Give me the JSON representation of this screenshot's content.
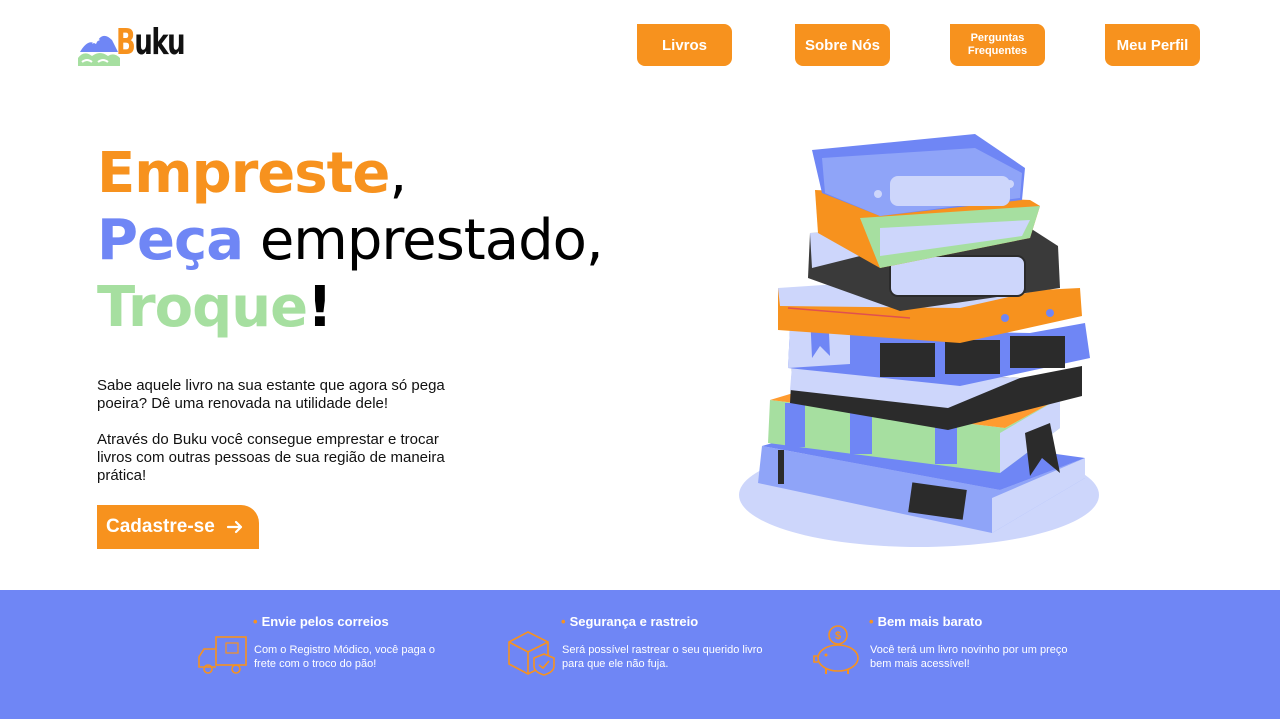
{
  "brand": {
    "name_b": "B",
    "name_rest": "uku"
  },
  "nav": {
    "items": [
      {
        "label": "Livros"
      },
      {
        "label": "Sobre Nós"
      },
      {
        "label": "Perguntas Frequentes"
      },
      {
        "label": "Meu Perfil"
      }
    ]
  },
  "hero": {
    "line1_word": "Empreste",
    "line1_punct": ",",
    "line2_word": "Peça",
    "line2_rest": " emprestado,",
    "line3_word": "Troque",
    "line3_punct": "!",
    "paragraph1": "Sabe aquele livro na sua estante que agora só pega poeira? Dê uma renovada na utilidade dele!",
    "paragraph2": "Através do Buku você consegue emprestar e trocar livros com outras pessoas de sua região de maneira prática!",
    "cta_label": "Cadastre-se"
  },
  "features": [
    {
      "icon": "delivery-truck-icon",
      "title": "Envie pelos correios",
      "text": "Com o Registro Módico, você paga o frete com o troco do pão!"
    },
    {
      "icon": "secure-package-icon",
      "title": "Segurança e rastreio",
      "text": "Será possível rastrear o seu querido livro para que ele não fuja."
    },
    {
      "icon": "piggy-bank-icon",
      "title": "Bem mais barato",
      "text": "Você terá um livro novinho por um preço bem mais acessível!"
    }
  ],
  "colors": {
    "orange": "#f7921e",
    "blue": "#6f86f5",
    "green": "#a6dfa0",
    "dark": "#2b2b2b",
    "pale_blue": "#cdd6fb"
  }
}
